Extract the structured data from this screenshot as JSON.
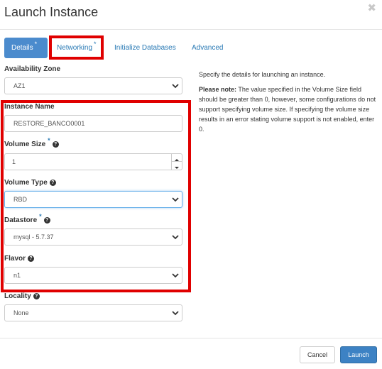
{
  "modal": {
    "title": "Launch Instance",
    "close_icon": "close-icon"
  },
  "tabs": [
    {
      "label": "Details",
      "required": "*"
    },
    {
      "label": "Networking",
      "required": "*"
    },
    {
      "label": "Initialize Databases"
    },
    {
      "label": "Advanced"
    }
  ],
  "form": {
    "availability_zone": {
      "label": "Availability Zone",
      "value": "AZ1"
    },
    "instance_name": {
      "label": "Instance Name",
      "required": "*",
      "value": "RESTORE_BANCO0001"
    },
    "volume_size": {
      "label": "Volume Size",
      "required": "*",
      "value": "1"
    },
    "volume_type": {
      "label": "Volume Type",
      "value": "RBD"
    },
    "datastore": {
      "label": "Datastore",
      "required": "*",
      "value": "mysql - 5.7.37"
    },
    "flavor": {
      "label": "Flavor",
      "value": "n1"
    },
    "locality": {
      "label": "Locality",
      "value": "None"
    }
  },
  "help_icon_glyph": "?",
  "info": {
    "intro": "Specify the details for launching an instance.",
    "note_label": "Please note:",
    "note_text": " The value specified in the Volume Size field should be greater than 0, however, some configurations do not support specifying volume size. If specifying the volume size results in an error stating volume support is not enabled, enter 0."
  },
  "footer": {
    "cancel_label": "Cancel",
    "launch_label": "Launch"
  },
  "colors": {
    "accent": "#4b8bcd",
    "highlight_box": "#e00000"
  }
}
